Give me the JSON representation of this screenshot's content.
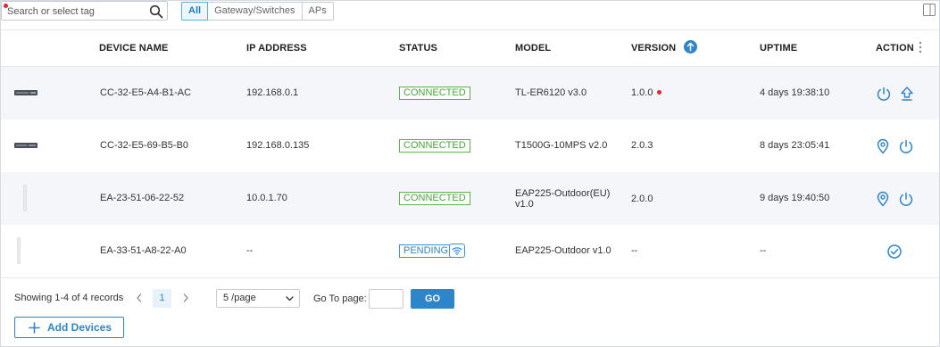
{
  "toolbar": {
    "search_placeholder": "Search or select tag",
    "filters": [
      "All",
      "Gateway/Switches",
      "APs"
    ],
    "active_filter": "All"
  },
  "table": {
    "headers": {
      "device_name": "DEVICE NAME",
      "ip_address": "IP ADDRESS",
      "status": "STATUS",
      "model": "MODEL",
      "version": "VERSION",
      "uptime": "UPTIME",
      "action": "ACTION"
    },
    "rows": [
      {
        "device_image": "gateway-router-image",
        "device_name": "CC-32-E5-A4-B1-AC",
        "ip": "192.168.0.1",
        "status": "CONNECTED",
        "model": "TL-ER6120 v3.0",
        "version": "1.0.0",
        "version_update_dot": true,
        "uptime": "4 days 19:38:10",
        "actions": [
          "power-icon",
          "upgrade-icon"
        ]
      },
      {
        "device_image": "switch-image",
        "device_name": "CC-32-E5-69-B5-B0",
        "ip": "192.168.0.135",
        "status": "CONNECTED",
        "model": "T1500G-10MPS v2.0",
        "version": "2.0.3",
        "uptime": "8 days 23:05:41",
        "actions": [
          "locate-icon",
          "power-icon"
        ]
      },
      {
        "device_image": "outdoor-ap-image",
        "device_name": "EA-23-51-06-22-52",
        "ip": "10.0.1.70",
        "status": "CONNECTED",
        "model_line1": "EAP225-Outdoor(EU)",
        "model_line2": "v1.0",
        "version": "2.0.0",
        "uptime": "9 days 19:40:50",
        "actions": [
          "locate-icon",
          "power-icon"
        ]
      },
      {
        "device_image": "outdoor-ap-image",
        "device_name": "EA-33-51-A8-22-A0",
        "ip": "--",
        "status": "PENDING",
        "status_icon": "wifi-icon",
        "model": "EAP225-Outdoor v1.0",
        "version": "--",
        "uptime": "--",
        "actions": [
          "adopt-check-icon"
        ]
      }
    ]
  },
  "footer": {
    "records_text": "Showing 1-4 of 4 records",
    "current_page": "1",
    "per_page": "5 /page",
    "goto_label": "Go To page:",
    "go_label": "GO",
    "add_devices_label": "Add Devices"
  },
  "colors": {
    "accent": "#2d86c9",
    "connected": "#47a63a",
    "alert": "#e5242b",
    "row_alt": "#f5f6f9"
  }
}
